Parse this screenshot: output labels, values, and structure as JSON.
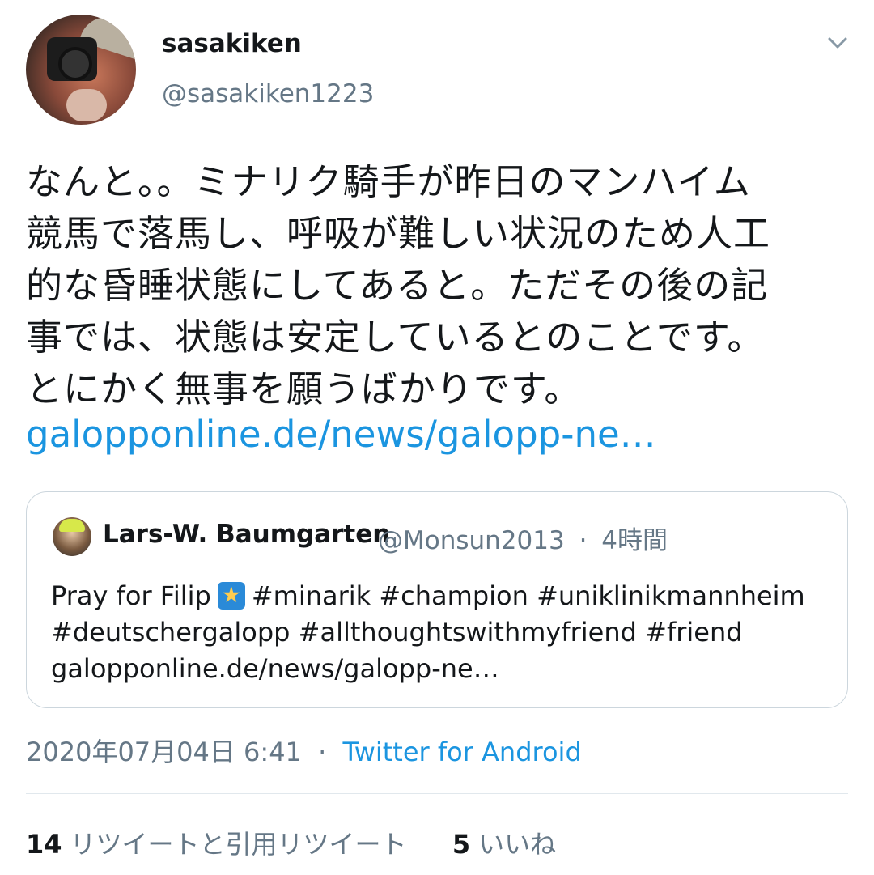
{
  "tweet": {
    "author": {
      "display_name": "sasakiken",
      "handle": "@sasakiken1223"
    },
    "text_lines": [
      "なんと。。ミナリク騎手が昨日のマンハイム",
      "競馬で落馬し、呼吸が難しい状況のため人工",
      "的な昏睡状態にしてあると。ただその後の記",
      "事では、状態は安定しているとのことです。",
      "とにかく無事を願うばかりです。"
    ],
    "link": "galopponline.de/news/galopp-ne…",
    "quoted": {
      "display_name": "Lars-W. Baumgarten",
      "handle": "@Monsun2013",
      "separator": "·",
      "time": "4時間",
      "body_line1_prefix": "Pray for Filip",
      "body_line1_suffix": "#minarik #champion #uniklinikmannheim",
      "body_line2": "#deutschergalopp #allthoughtswithmyfriend #friend",
      "body_line3": "galopponline.de/news/galopp-ne…"
    },
    "timestamp": "2020年07月04日 6:41",
    "timestamp_separator": "·",
    "source": "Twitter for Android",
    "stats": {
      "retweets_count": "14",
      "retweets_label": "リツイートと引用リツイート",
      "likes_count": "5",
      "likes_label": "いいね"
    }
  },
  "icons": {
    "menu": "chevron-down-icon",
    "emoji": "shooting-star-emoji"
  },
  "colors": {
    "link": "#1b95e0",
    "secondary_text": "#657786",
    "primary_text": "#14171a",
    "border": "#ccd6dd"
  }
}
